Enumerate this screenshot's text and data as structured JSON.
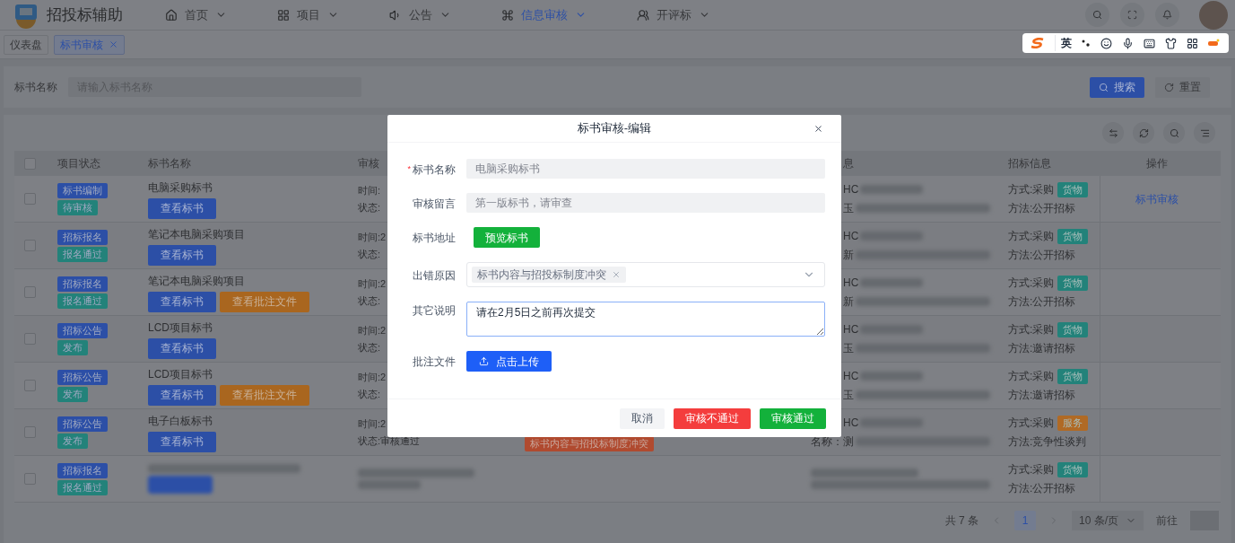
{
  "app": {
    "title": "招投标辅助"
  },
  "nav": [
    {
      "label": "首页",
      "selected": false
    },
    {
      "label": "项目",
      "selected": false
    },
    {
      "label": "公告",
      "selected": false
    },
    {
      "label": "信息审核",
      "selected": true
    },
    {
      "label": "开评标",
      "selected": false
    }
  ],
  "tabs": [
    {
      "label": "仪表盘",
      "selected": false,
      "closable": false
    },
    {
      "label": "标书审核",
      "selected": true,
      "closable": true
    }
  ],
  "search": {
    "label": "标书名称",
    "placeholder": "请输入标书名称",
    "buttons": [
      {
        "label": "搜索",
        "kind": "primary"
      },
      {
        "label": "重置",
        "kind": "default"
      }
    ]
  },
  "table": {
    "header_checked": false,
    "columns": {
      "status": "项目状态",
      "name": "标书名称",
      "time": "审核",
      "info": "息",
      "bidding": "招标信息",
      "action": "操作"
    },
    "rows": [
      {
        "checked": false,
        "statuses": [
          {
            "label": "标书编制",
            "color": "#2c4fa6"
          },
          {
            "label": "待审核",
            "color": "#23827a"
          }
        ],
        "name": "电脑采购标书",
        "buttons": [
          {
            "label": "查看标书",
            "kind": "view"
          }
        ],
        "time": [
          "时间:",
          "状态:"
        ],
        "info": [
          {
            "text": "HC"
          },
          {
            "text": "玉"
          }
        ],
        "way": "方式:采购",
        "category": {
          "label": "货物",
          "color": "#23827a"
        },
        "method": "方法:公开招标",
        "action": "标书审核"
      },
      {
        "checked": false,
        "statuses": [
          {
            "label": "招标报名",
            "color": "#2c4fa6"
          },
          {
            "label": "报名通过",
            "color": "#23827a"
          }
        ],
        "name": "笔记本电脑采购项目",
        "buttons": [
          {
            "label": "查看标书",
            "kind": "view"
          }
        ],
        "time": [
          "时间:2",
          "状态:"
        ],
        "info": [
          {
            "text": "HC"
          },
          {
            "text": "新"
          }
        ],
        "way": "方式:采购",
        "category": {
          "label": "货物",
          "color": "#23827a"
        },
        "method": "方法:公开招标"
      },
      {
        "checked": false,
        "statuses": [
          {
            "label": "招标报名",
            "color": "#2c4fa6"
          },
          {
            "label": "报名通过",
            "color": "#23827a"
          }
        ],
        "name": "笔记本电脑采购项目",
        "buttons": [
          {
            "label": "查看标书",
            "kind": "view"
          },
          {
            "label": "查看批注文件",
            "kind": "annotate"
          }
        ],
        "time": [
          "时间:2",
          "状态:"
        ],
        "info": [
          {
            "text": "HC"
          },
          {
            "text": "新"
          }
        ],
        "way": "方式:采购",
        "category": {
          "label": "货物",
          "color": "#23827a"
        },
        "method": "方法:公开招标"
      },
      {
        "checked": false,
        "statuses": [
          {
            "label": "招标公告",
            "color": "#2c4fa6"
          },
          {
            "label": "发布",
            "color": "#23827a"
          }
        ],
        "name": "LCD项目标书",
        "buttons": [
          {
            "label": "查看标书",
            "kind": "view"
          }
        ],
        "time": [
          "时间:2",
          "状态:"
        ],
        "info": [
          {
            "text": "HC"
          },
          {
            "text": "玉"
          }
        ],
        "way": "方式:采购",
        "category": {
          "label": "货物",
          "color": "#23827a"
        },
        "method": "方法:邀请招标"
      },
      {
        "checked": false,
        "statuses": [
          {
            "label": "招标公告",
            "color": "#2c4fa6"
          },
          {
            "label": "发布",
            "color": "#23827a"
          }
        ],
        "name": "LCD项目标书",
        "buttons": [
          {
            "label": "查看标书",
            "kind": "view"
          },
          {
            "label": "查看批注文件",
            "kind": "annotate"
          }
        ],
        "time": [
          "时间:2",
          "状态:"
        ],
        "info": [
          {
            "text": "HC"
          },
          {
            "text": "玉"
          }
        ],
        "way": "方式:采购",
        "category": {
          "label": "货物",
          "color": "#23827a"
        },
        "method": "方法:邀请招标"
      },
      {
        "checked": false,
        "statuses": [
          {
            "label": "招标公告",
            "color": "#2c4fa6"
          },
          {
            "label": "发布",
            "color": "#23827a"
          }
        ],
        "name": "电子白板标书",
        "buttons": [
          {
            "label": "查看标书",
            "kind": "view"
          }
        ],
        "time": [
          "时间:2",
          "状态:审核通过"
        ],
        "reason": "标书内容与招投标制度冲突",
        "info": [
          {
            "text": "HC"
          },
          {
            "prefix": "名称：",
            "text": "测"
          }
        ],
        "way": "方式:采购",
        "category": {
          "label": "服务",
          "color": "#b06a25"
        },
        "method": "方法:竞争性谈判"
      },
      {
        "checked": false,
        "blurred": true,
        "statuses": [
          {
            "label": "招标报名",
            "color": "#2c4fa6"
          },
          {
            "label": "报名通过",
            "color": "#23827a"
          }
        ],
        "way": "方式:采购",
        "category": {
          "label": "货物",
          "color": "#23827a"
        },
        "method": "方法:公开招标"
      }
    ]
  },
  "pagination": {
    "total": "共 7 条",
    "pages": [
      {
        "label": "1",
        "selected": true
      }
    ],
    "page_size": "10 条/页",
    "goto": "前往"
  },
  "modal": {
    "title": "标书审核-编辑",
    "required_mark": "*",
    "fields": [
      {
        "kind": "input",
        "label": "标书名称",
        "required": true,
        "value": "电脑采购标书",
        "disabled": true
      },
      {
        "kind": "input",
        "label": "审核留言",
        "required": false,
        "value": "第一版标书，请审查",
        "disabled": true
      },
      {
        "kind": "button",
        "label": "标书地址",
        "required": false,
        "button": "预览标书"
      },
      {
        "kind": "select",
        "label": "出错原因",
        "required": false,
        "tags": [
          "标书内容与招投标制度冲突"
        ]
      },
      {
        "kind": "textarea",
        "label": "其它说明",
        "required": false,
        "value": "请在2月5日之前再次提交"
      },
      {
        "kind": "upload",
        "label": "批注文件",
        "required": false,
        "button": "点击上传"
      }
    ],
    "buttons": [
      {
        "label": "取消",
        "kind": "default"
      },
      {
        "label": "审核不通过",
        "kind": "danger"
      },
      {
        "label": "审核通过",
        "kind": "success"
      }
    ]
  },
  "ime_bar": {
    "mode": "英"
  }
}
